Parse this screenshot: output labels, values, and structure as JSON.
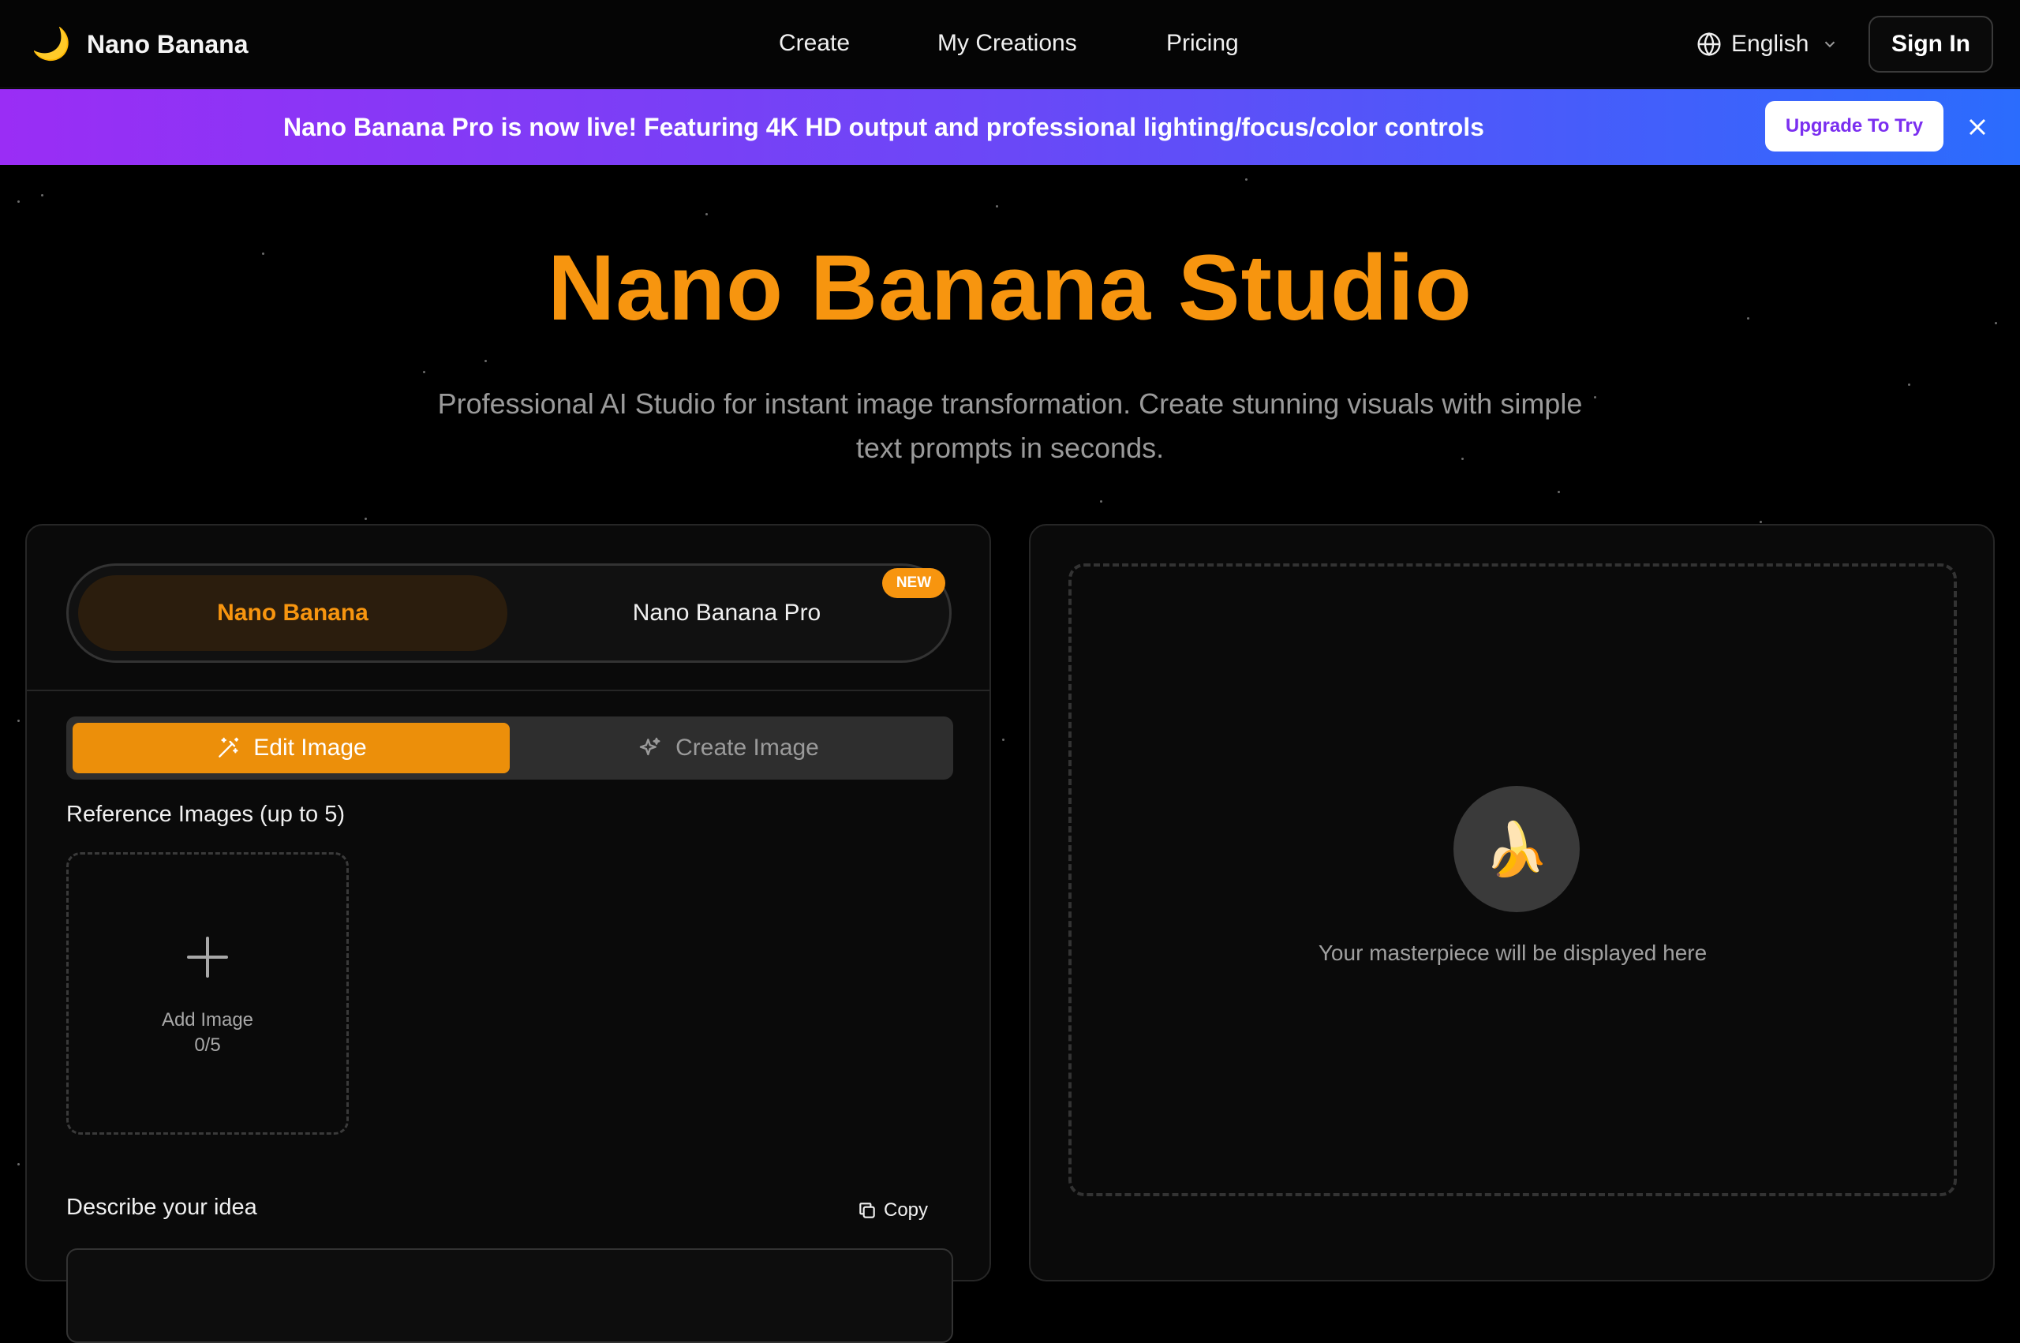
{
  "header": {
    "brand_icon": "🌙",
    "brand_name": "Nano Banana",
    "nav": [
      {
        "label": "Create"
      },
      {
        "label": "My Creations"
      },
      {
        "label": "Pricing"
      }
    ],
    "language": "English",
    "sign_in": "Sign In"
  },
  "banner": {
    "message": "Nano Banana Pro is now live! Featuring 4K HD output and professional lighting/focus/color controls",
    "upgrade_label": "Upgrade To Try"
  },
  "hero": {
    "title": "Nano Banana Studio",
    "subtitle": "Professional AI Studio for instant image transformation. Create stunning visuals with simple text prompts in seconds."
  },
  "left_panel": {
    "models": [
      {
        "label": "Nano Banana",
        "active": true
      },
      {
        "label": "Nano Banana Pro",
        "active": false
      }
    ],
    "new_badge": "NEW",
    "modes": [
      {
        "label": "Edit Image",
        "icon": "magic-wand-icon",
        "active": true
      },
      {
        "label": "Create Image",
        "icon": "sparkles-icon",
        "active": false
      }
    ],
    "reference_label": "Reference Images (up to 5)",
    "add_image_label": "Add Image",
    "add_image_count": "0/5",
    "describe_label": "Describe your idea",
    "copy_label": "Copy"
  },
  "right_panel": {
    "placeholder_icon": "🍌",
    "placeholder_text": "Your masterpiece will be displayed here"
  },
  "colors": {
    "accent": "#f7950f",
    "banner_start": "#9a2df5",
    "banner_end": "#2b6cfd",
    "upgrade_text": "#7b2ff0"
  }
}
